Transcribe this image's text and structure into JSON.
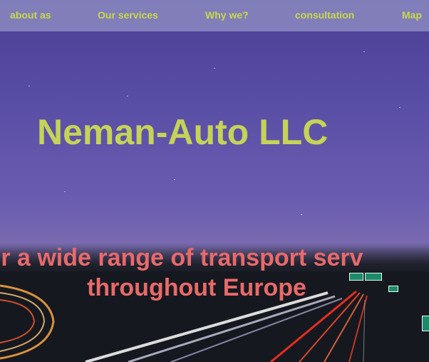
{
  "nav": {
    "items": [
      {
        "label": "about as"
      },
      {
        "label": "Our services"
      },
      {
        "label": "Why we?"
      },
      {
        "label": "consultation"
      },
      {
        "label": "Map"
      }
    ]
  },
  "hero": {
    "title": "Neman-Auto LLC",
    "tagline_line1": "er a wide range of transport serv",
    "tagline_line2": "throughout Europe"
  },
  "colors": {
    "nav_text": "#c9d84a",
    "title": "#c5d356",
    "tagline": "#e86a6a",
    "nav_bg": "#9696c8",
    "sky": "#5a4fa6"
  }
}
